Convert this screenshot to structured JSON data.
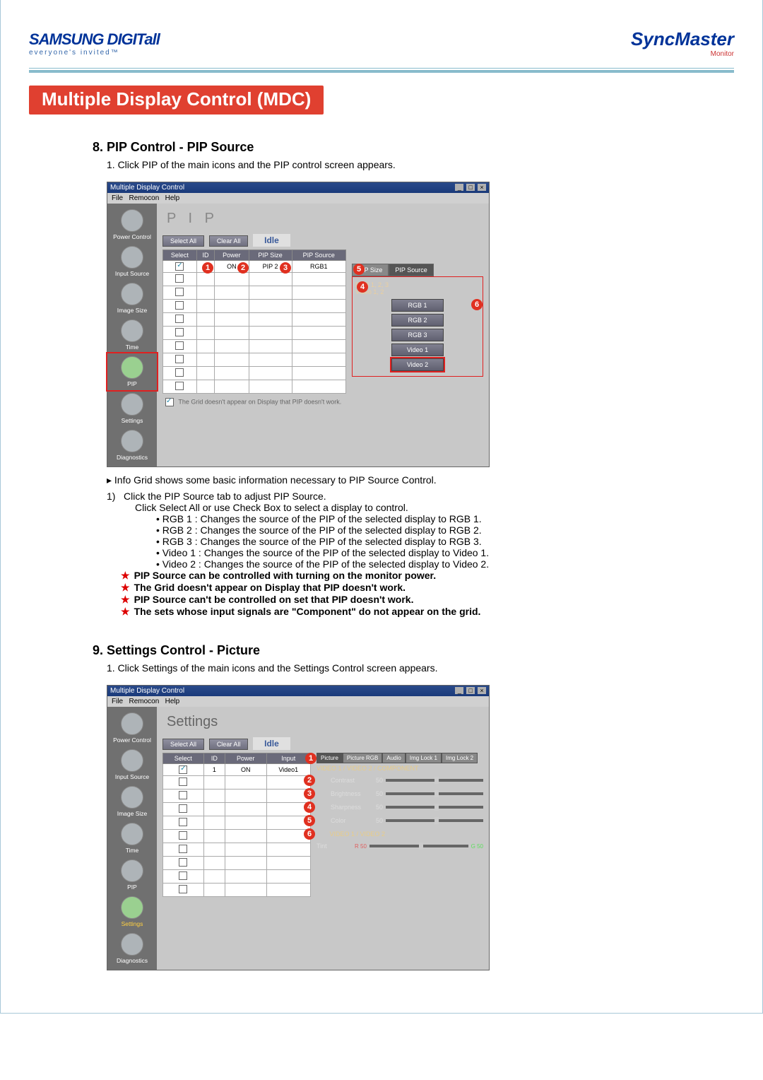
{
  "brand": {
    "left_main": "SAMSUNG DIGITall",
    "left_tag": "everyone's  invited™",
    "right_main": "SyncMaster",
    "right_sub": "Monitor"
  },
  "page_title": "Multiple Display Control (MDC)",
  "section8": {
    "heading": "8. PIP Control - PIP Source",
    "intro": "1.  Click PIP of the main icons and the PIP control screen appears.",
    "info_line": "Info Grid shows some basic information necessary to PIP Source Control.",
    "step1_a": "Click the PIP Source tab to adjust PIP Source.",
    "step1_b": "Click Select All or use Check Box to select a display to control.",
    "bullets": [
      "RGB 1 : Changes the source of the PIP of the selected display to RGB 1.",
      "RGB 2 : Changes the source of the PIP of the selected display to RGB 2.",
      "RGB 3 : Changes the source of the PIP of the selected display to RGB 3.",
      "Video 1 : Changes the source of the PIP of the selected display to Video 1.",
      "Video 2 : Changes the source of the PIP of the selected display to Video 2."
    ],
    "notes": [
      "PIP Source can be controlled with turning on the monitor power.",
      "The Grid doesn't appear on Display that PIP doesn't work.",
      "PIP Source can't be controlled on set that PIP doesn't work.",
      "The sets whose input signals are \"Component\" do not appear on the grid."
    ]
  },
  "section9": {
    "heading": "9. Settings Control - Picture",
    "intro": "1.  Click Settings of the main icons and the Settings Control screen appears."
  },
  "app": {
    "window_title": "Multiple Display Control",
    "menu": [
      "File",
      "Remocon",
      "Help"
    ],
    "sidebar": [
      "Power Control",
      "Input Source",
      "Image Size",
      "Time",
      "PIP",
      "Settings",
      "Diagnostics"
    ],
    "buttons": {
      "select_all": "Select All",
      "clear_all": "Clear All"
    },
    "idle": "Idle",
    "grid_headers_pip": [
      "Select",
      "ID",
      "Power",
      "PIP Size",
      "PIP Source"
    ],
    "grid_row_pip": [
      "1",
      "ON",
      "PIP 2",
      "RGB1"
    ],
    "pip_tabs": [
      "PIP Size",
      "PIP Source"
    ],
    "pip_group1": "RGB 1, 2, 3\nVideo 1, 2",
    "pip_sources": [
      "RGB 1",
      "RGB 2",
      "RGB 3",
      "Video 1",
      "Video 2"
    ],
    "grid_note": "The Grid doesn't appear on Display that PIP doesn't work.",
    "grid_headers_set": [
      "Select",
      "ID",
      "Power",
      "Input"
    ],
    "grid_row_set": [
      "1",
      "ON",
      "Video1"
    ],
    "settings_title": "Settings",
    "settings_tabs": [
      "Picture",
      "Picture RGB",
      "Audio",
      "Img Lock 1",
      "Img Lock 2"
    ],
    "settings_group1": "VIDEO 1 / VIDEO 2 / COMPONENT",
    "sliders": [
      {
        "label": "Contrast",
        "value": "50"
      },
      {
        "label": "Brightness",
        "value": "50"
      },
      {
        "label": "Sharpness",
        "value": "50"
      },
      {
        "label": "Color",
        "value": "50"
      }
    ],
    "settings_group2": "VIDEO 1 / VIDEO 2",
    "tint_label": "Tint",
    "tint_left": "R 50",
    "tint_right": "G 50",
    "pip_title": "P I P"
  }
}
